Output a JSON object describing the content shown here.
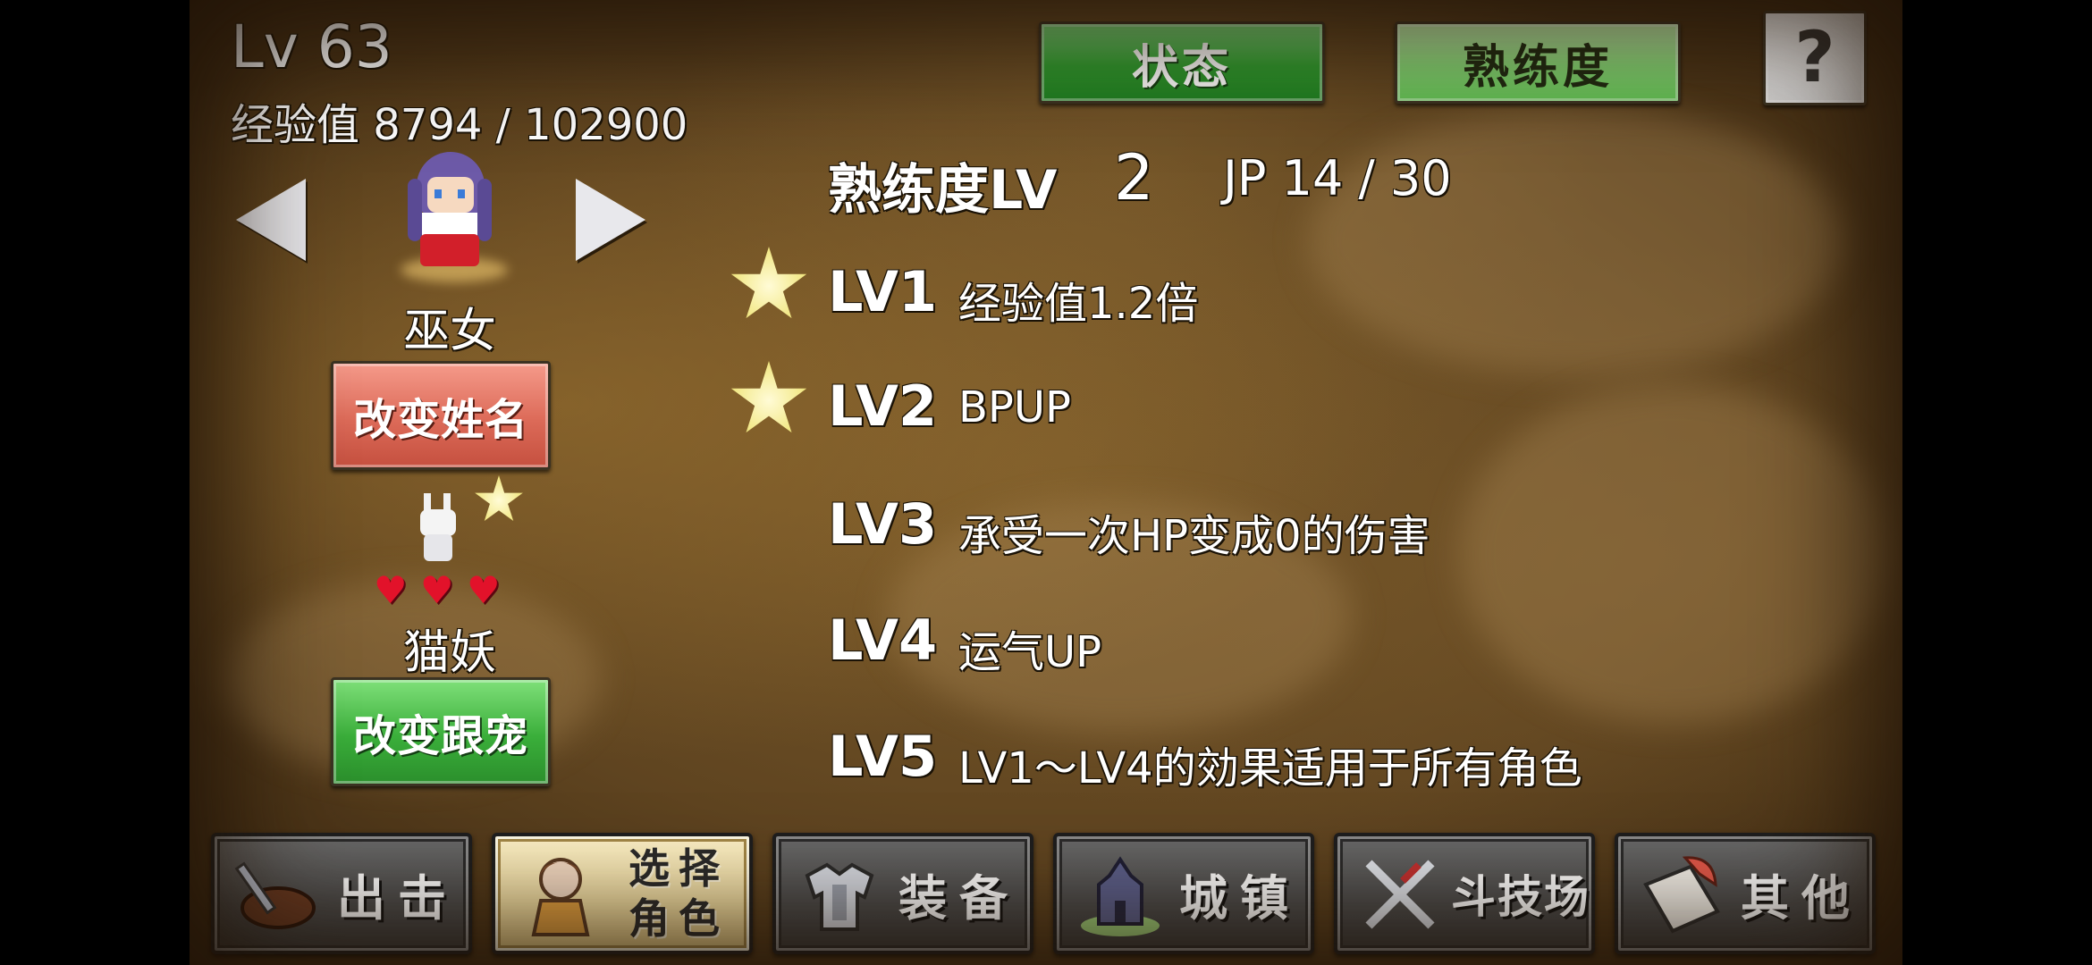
{
  "player": {
    "level": "Lv 63",
    "exp": "经验值 8794 / 102900"
  },
  "tabs": {
    "status": "状态",
    "proficiency": "熟练度",
    "help": "?"
  },
  "character": {
    "job": "巫女",
    "rename_button": "改变姓名"
  },
  "pet": {
    "name": "猫妖",
    "hearts": 3,
    "change_button": "改变跟宠"
  },
  "proficiency": {
    "header": "熟练度LV",
    "level": "2",
    "jp": "JP 14 / 30",
    "rows": [
      {
        "label": "LV1",
        "effect": "经验值1.2倍",
        "starred": true
      },
      {
        "label": "LV2",
        "effect": "BPUP",
        "starred": true
      },
      {
        "label": "LV3",
        "effect": "承受一次HP变成0的伤害",
        "starred": false
      },
      {
        "label": "LV4",
        "effect": "运气UP",
        "starred": false
      },
      {
        "label": "LV5",
        "effect": "LV1～LV4的効果适用于所有角色",
        "starred": false
      }
    ]
  },
  "nav": {
    "sortie": "出击",
    "select_line1": "选择",
    "select_line2": "角色",
    "equip": "装备",
    "town": "城镇",
    "arena": "斗技场",
    "other": "其他"
  },
  "icons": {
    "prev": "left-arrow-icon",
    "next": "right-arrow-icon",
    "star": "star-icon",
    "heart": "heart-icon"
  }
}
